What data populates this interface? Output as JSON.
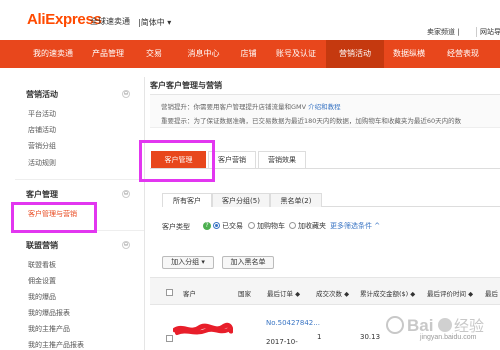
{
  "header": {
    "logo": "AliExpress",
    "logo_sub": "全球速卖通",
    "language": "|简体中",
    "language_caret": "▾",
    "seller_menu": "卖家频道 |",
    "site_link": "网站导"
  },
  "nav": {
    "items": [
      {
        "label": "我的速卖通"
      },
      {
        "label": "产品管理"
      },
      {
        "label": "交易"
      },
      {
        "label": "消息中心"
      },
      {
        "label": "店铺"
      },
      {
        "label": "账号及认证"
      },
      {
        "label": "营销活动",
        "active": true
      },
      {
        "label": "数据纵横"
      },
      {
        "label": "经营表现"
      }
    ]
  },
  "sidebar": {
    "sections": [
      {
        "title": "营销活动",
        "toggle": "⊖",
        "items": [
          {
            "label": "平台活动"
          },
          {
            "label": "店铺活动"
          },
          {
            "label": "营销分组"
          },
          {
            "label": "活动规则"
          }
        ]
      },
      {
        "title": "客户管理",
        "toggle": "⊖",
        "items": [
          {
            "label": "客户管理与营销",
            "active": true
          }
        ]
      },
      {
        "title": "联盟营销",
        "toggle": "⊖",
        "items": [
          {
            "label": "联盟看板"
          },
          {
            "label": "佣金设置"
          },
          {
            "label": "我的爆品"
          },
          {
            "label": "我的爆品报表"
          },
          {
            "label": "我的主推产品"
          },
          {
            "label": "我的主推产品报表"
          }
        ]
      }
    ]
  },
  "main": {
    "title": "客户客户管理与营销",
    "notice_1_text": "营销提升：你需要用客户管理提升店铺流量和GMV",
    "notice_1_link": "介绍和教程",
    "notice_2_text": "重要提示：为了保证数据准确，已交易数据为最近180天内的数据，加购物车和收藏夹为最近60天内的数",
    "tabs": [
      {
        "label": "客户管理",
        "active": true
      },
      {
        "label": "客户营销"
      },
      {
        "label": "营销效果"
      }
    ],
    "subtabs": [
      {
        "label": "所有客户",
        "active": true
      },
      {
        "label": "客户分组(5)"
      },
      {
        "label": "黑名单(2)"
      }
    ],
    "filter": {
      "label": "客户类型",
      "help_icon": "?",
      "options": [
        {
          "label": "已交易",
          "checked": true
        },
        {
          "label": "加购物车"
        },
        {
          "label": "加收藏夹"
        }
      ],
      "more": "更多筛选条件 ^"
    },
    "buttons": {
      "add_group": "加入分组 ▾",
      "add_blacklist": "加入黑名单"
    },
    "table": {
      "headers": [
        "客户",
        "国家",
        "最后订单 ◆",
        "成交次数 ◆",
        "累计成交金额($) ◆",
        "最后评价时间 ◆",
        "最后"
      ],
      "rows": [
        {
          "order_no": "No.50427842...",
          "order_date": "2017-10-",
          "count": "1",
          "amount": "30.13"
        }
      ]
    },
    "watermark": "jingyan.baidu.com"
  },
  "colors": {
    "brand": "#e8471c",
    "nav_active": "#c5390f",
    "highlight": "#e236f0",
    "link": "#3a75c4"
  }
}
